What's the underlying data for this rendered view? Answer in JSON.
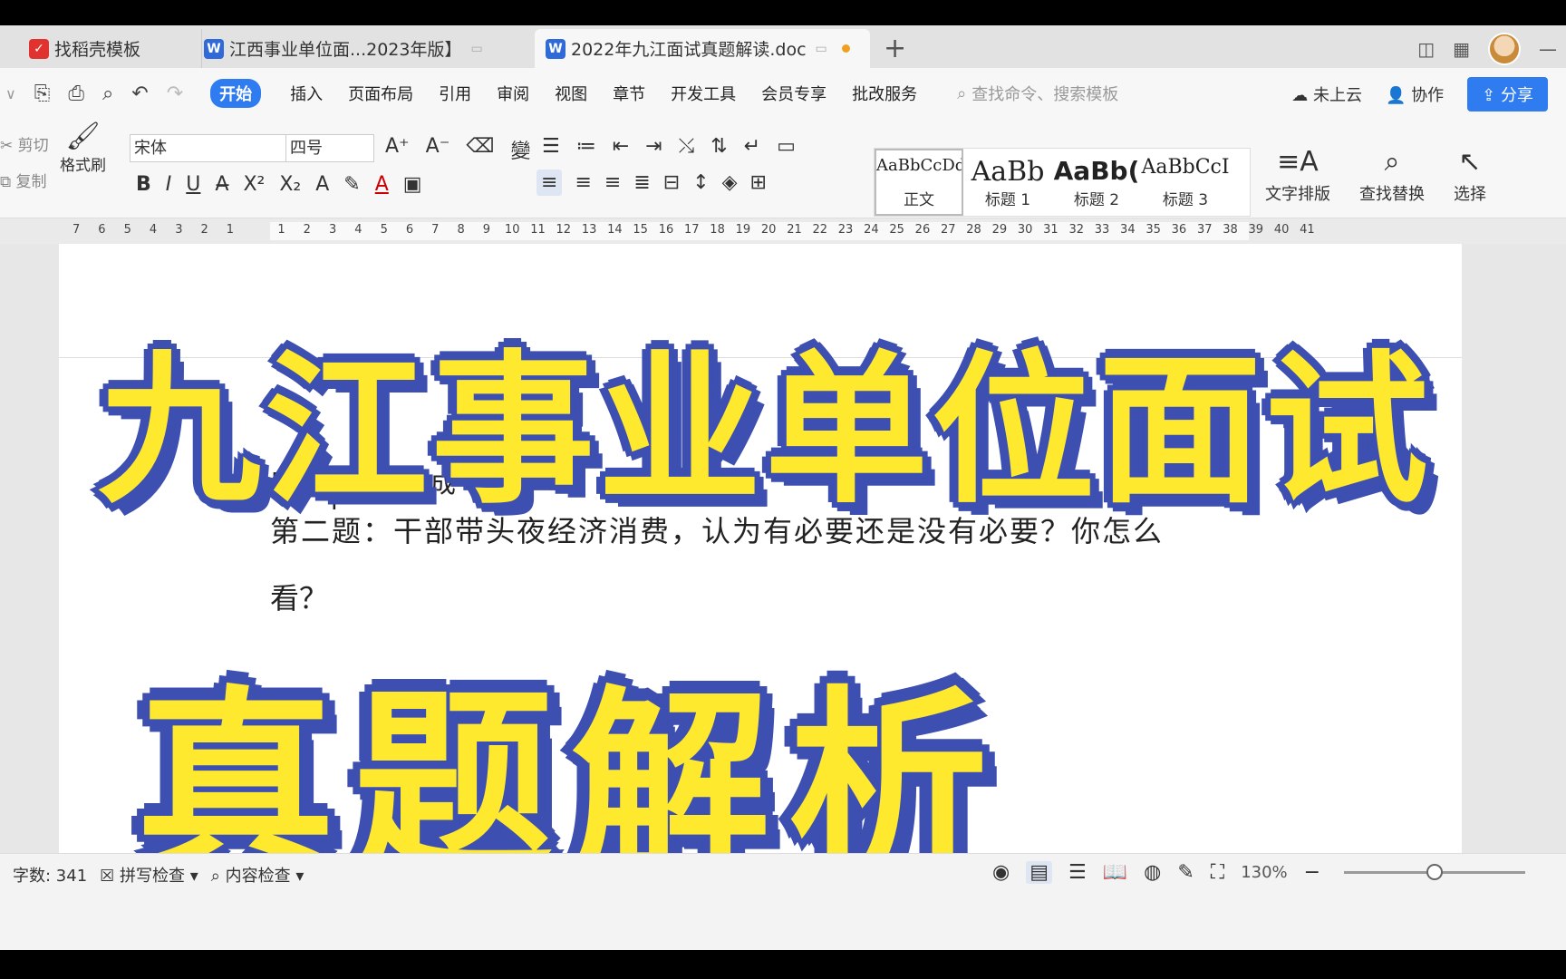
{
  "tabs": [
    {
      "label": "找稻壳模板",
      "icon": "docer-icon",
      "color": "#e0332f"
    },
    {
      "label": "江西事业单位面...2023年版】",
      "icon": "wps-writer-icon",
      "color": "#2f6ad8"
    },
    {
      "label": "2022年九江面试真题解读.doc",
      "icon": "wps-writer-icon",
      "color": "#2f6ad8"
    }
  ],
  "menu": {
    "items": [
      "开始",
      "插入",
      "页面布局",
      "引用",
      "审阅",
      "视图",
      "章节",
      "开发工具",
      "会员专享",
      "批改服务"
    ],
    "search_placeholder": "查找命令、搜索模板",
    "cloud": "未上云",
    "collab": "协作",
    "share": "分享"
  },
  "ribbon": {
    "cut": "剪切",
    "copy": "复制",
    "format_brush": "格式刷",
    "font": "宋体",
    "font_size": "四号",
    "styles": [
      {
        "preview": "AaBbCcDd",
        "name": "正文"
      },
      {
        "preview": "AaBb",
        "name": "标题 1"
      },
      {
        "preview": "AaBb(",
        "name": "标题 2"
      },
      {
        "preview": "AaBbCcI",
        "name": "标题 3"
      }
    ],
    "text_layout": "文字排版",
    "find_replace": "查找替换",
    "select": "选择"
  },
  "ruler": {
    "numbers": [
      "7",
      "6",
      "5",
      "4",
      "3",
      "2",
      "1",
      "",
      "1",
      "2",
      "3",
      "4",
      "5",
      "6",
      "7",
      "8",
      "9",
      "10",
      "11",
      "12",
      "13",
      "14",
      "15",
      "16",
      "17",
      "18",
      "19",
      "20",
      "21",
      "22",
      "23",
      "24",
      "25",
      "26",
      "27",
      "28",
      "29",
      "30",
      "31",
      "32",
      "33",
      "34",
      "35",
      "36",
      "37",
      "38",
      "39",
      "40",
      "41"
    ]
  },
  "document": {
    "heading_partial": "2",
    "author_line": "原因教育    黄国成",
    "question_line1": "第二题：干部带头夜经济消费，认为有必要还是没有必要？你怎么",
    "question_line2": "看？"
  },
  "overlay": {
    "title_top": "九江事业单位面试",
    "title_bottom": "真题解析",
    "fill_color": "#ffe92e",
    "stroke_color": "#3d4fb0"
  },
  "status": {
    "word_count": "字数: 341",
    "spell_check": "拼写检查",
    "content_check": "内容检查",
    "zoom": "130%",
    "zoom_level": 0.5
  }
}
